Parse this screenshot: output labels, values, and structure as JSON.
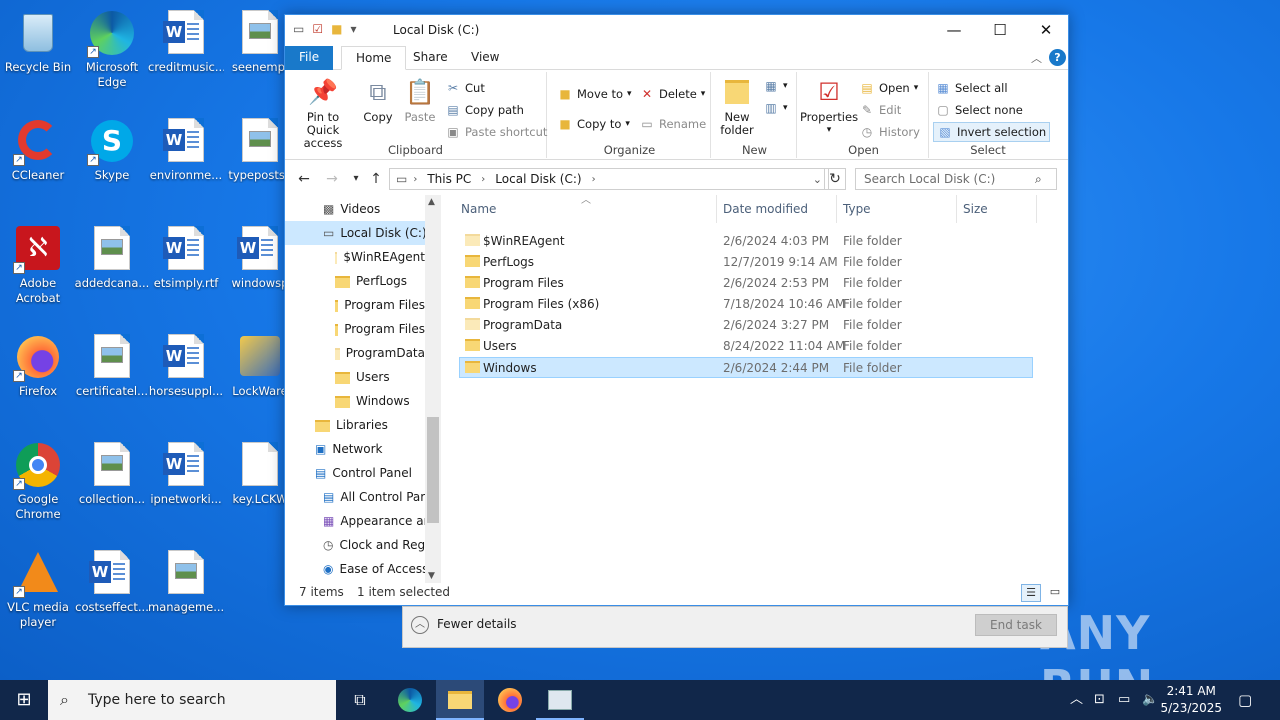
{
  "desktop": {
    "icons": [
      {
        "label": "Recycle Bin"
      },
      {
        "label": "Microsoft Edge"
      },
      {
        "label": "creditmusic..."
      },
      {
        "label": "seenempl"
      },
      {
        "label": "CCleaner"
      },
      {
        "label": "Skype"
      },
      {
        "label": "environme..."
      },
      {
        "label": "typeposts.j"
      },
      {
        "label": "Adobe Acrobat"
      },
      {
        "label": "addedcana..."
      },
      {
        "label": "etsimply.rtf"
      },
      {
        "label": "windowsp"
      },
      {
        "label": "Firefox"
      },
      {
        "label": "certificatel..."
      },
      {
        "label": "horsesuppl..."
      },
      {
        "label": "LockWare"
      },
      {
        "label": "Google Chrome"
      },
      {
        "label": "collection..."
      },
      {
        "label": "ipnetworki..."
      },
      {
        "label": "key.LCKW"
      },
      {
        "label": "VLC media player"
      },
      {
        "label": "costseffect..."
      },
      {
        "label": "manageme..."
      }
    ]
  },
  "explorer": {
    "title": "Local Disk (C:)",
    "tabs": {
      "file": "File",
      "home": "Home",
      "share": "Share",
      "view": "View"
    },
    "ribbon": {
      "clipboard": {
        "group": "Clipboard",
        "pin": "Pin to Quick access",
        "copy": "Copy",
        "paste": "Paste",
        "cut": "Cut",
        "copy_path": "Copy path",
        "paste_shortcut": "Paste shortcut"
      },
      "organize": {
        "group": "Organize",
        "move_to": "Move to",
        "copy_to": "Copy to",
        "delete": "Delete",
        "rename": "Rename"
      },
      "new": {
        "group": "New",
        "new_folder": "New folder"
      },
      "open": {
        "group": "Open",
        "properties": "Properties",
        "open": "Open",
        "edit": "Edit",
        "history": "History"
      },
      "select": {
        "group": "Select",
        "select_all": "Select all",
        "select_none": "Select none",
        "invert": "Invert selection"
      }
    },
    "address": {
      "crumb1": "This PC",
      "crumb2": "Local Disk (C:)"
    },
    "search": {
      "placeholder": "Search Local Disk (C:)"
    },
    "nav": [
      "Videos",
      "Local Disk (C:)",
      "$WinREAgent",
      "PerfLogs",
      "Program Files",
      "Program Files",
      "ProgramData",
      "Users",
      "Windows",
      "Libraries",
      "Network",
      "Control Panel",
      "All Control Par",
      "Appearance an",
      "Clock and Regi",
      "Ease of Access"
    ],
    "columns": {
      "name": "Name",
      "date": "Date modified",
      "type": "Type",
      "size": "Size"
    },
    "files": [
      {
        "name": "$WinREAgent",
        "date": "2/6/2024 4:03 PM",
        "type": "File folder"
      },
      {
        "name": "PerfLogs",
        "date": "12/7/2019 9:14 AM",
        "type": "File folder"
      },
      {
        "name": "Program Files",
        "date": "2/6/2024 2:53 PM",
        "type": "File folder"
      },
      {
        "name": "Program Files (x86)",
        "date": "7/18/2024 10:46 AM",
        "type": "File folder"
      },
      {
        "name": "ProgramData",
        "date": "2/6/2024 3:27 PM",
        "type": "File folder"
      },
      {
        "name": "Users",
        "date": "8/24/2022 11:04 AM",
        "type": "File folder"
      },
      {
        "name": "Windows",
        "date": "2/6/2024 2:44 PM",
        "type": "File folder"
      }
    ],
    "status": {
      "count": "7 items",
      "selected": "1 item selected"
    }
  },
  "taskmgr": {
    "fewer_details": "Fewer details",
    "end_task": "End task"
  },
  "taskbar": {
    "search_placeholder": "Type here to search",
    "time": "2:41 AM",
    "date": "5/23/2025"
  },
  "watermark": "ANY RUN"
}
